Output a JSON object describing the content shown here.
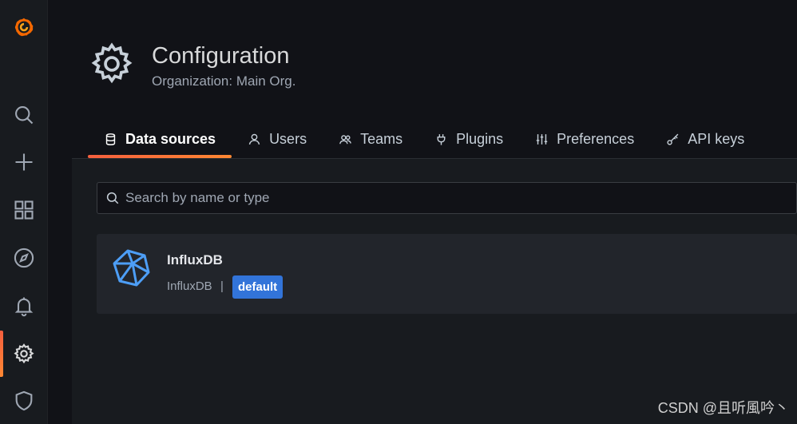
{
  "sidebar": {
    "items": [
      {
        "icon": "grafana-logo-icon"
      },
      {
        "icon": "search-icon"
      },
      {
        "icon": "plus-icon"
      },
      {
        "icon": "dashboards-icon"
      },
      {
        "icon": "explore-compass-icon"
      },
      {
        "icon": "alerting-bell-icon"
      },
      {
        "icon": "configuration-gear-icon",
        "active": true
      },
      {
        "icon": "server-admin-shield-icon"
      }
    ],
    "accent": "#f55f3e"
  },
  "header": {
    "title": "Configuration",
    "subtitle": "Organization: Main Org."
  },
  "tabs": [
    {
      "label": "Data sources",
      "icon": "database-icon",
      "active": true
    },
    {
      "label": "Users",
      "icon": "user-icon"
    },
    {
      "label": "Teams",
      "icon": "users-icon"
    },
    {
      "label": "Plugins",
      "icon": "plug-icon"
    },
    {
      "label": "Preferences",
      "icon": "sliders-icon"
    },
    {
      "label": "API keys",
      "icon": "key-icon"
    }
  ],
  "search": {
    "placeholder": "Search by name or type",
    "value": ""
  },
  "datasources": [
    {
      "name": "InfluxDB",
      "type": "InfluxDB",
      "separator": "|",
      "badge": "default",
      "badge_color": "#3274d9",
      "icon": "influxdb-logo-icon"
    }
  ],
  "watermark": "CSDN @且听風吟丶"
}
